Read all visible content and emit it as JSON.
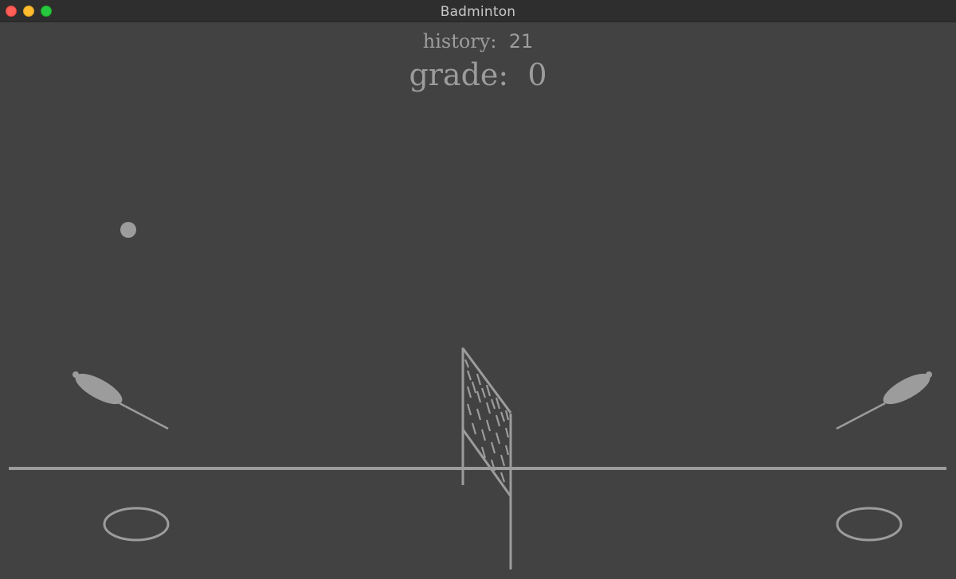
{
  "window": {
    "title": "Badminton"
  },
  "scoreboard": {
    "history_label": "history:",
    "history_value": "21",
    "grade_label": "grade:",
    "grade_value": "0"
  },
  "colors": {
    "background": "#424242",
    "titlebar": "#2e2e2e",
    "foreground": "#9c9c9c"
  },
  "icons": {
    "close": "close-icon",
    "minimize": "minimize-icon",
    "maximize": "maximize-icon"
  }
}
